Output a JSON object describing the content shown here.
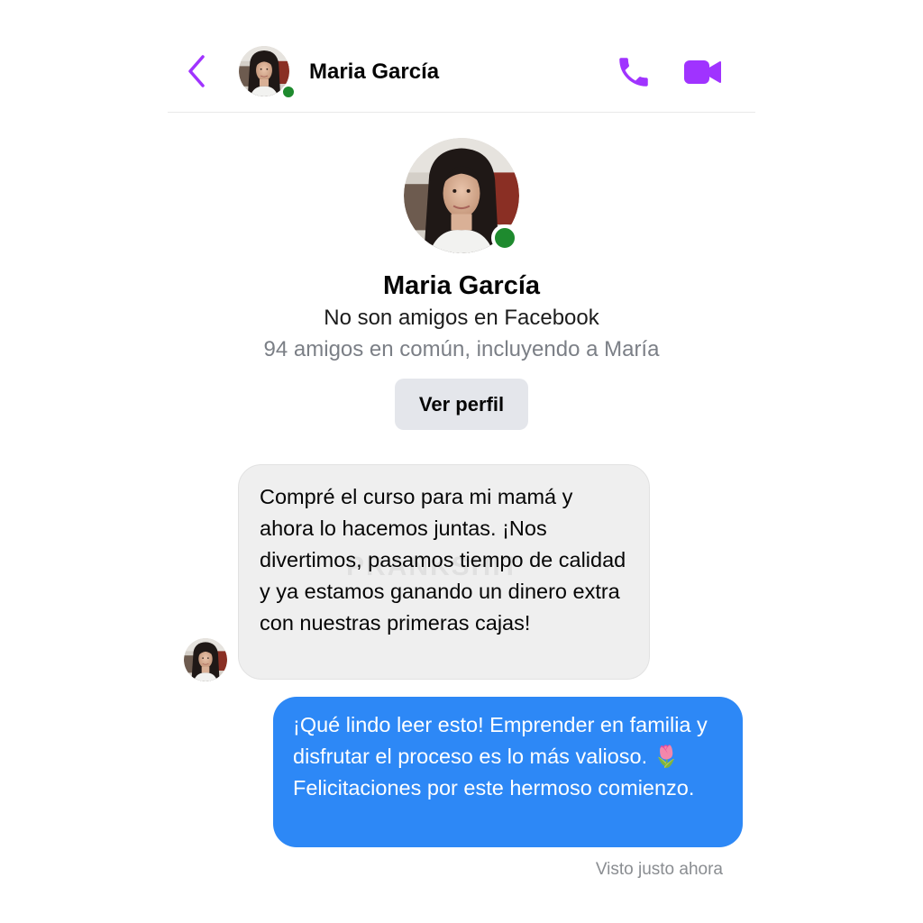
{
  "header": {
    "contact_name": "Maria García",
    "online": true,
    "back_icon": "chevron-left-icon",
    "call_icon": "phone-icon",
    "video_icon": "video-camera-icon"
  },
  "profile": {
    "name": "Maria García",
    "friend_status": "No son amigos en Facebook",
    "mutual_friends": "94 amigos en común, incluyendo a María",
    "view_profile_label": "Ver perfil"
  },
  "messages": [
    {
      "direction": "incoming",
      "text": "Compré el curso para mi mamá y ahora lo hacemos juntas. ¡Nos divertimos, pasamos tiempo de calidad y ya estamos ganando un dinero extra con nuestras primeras cajas!"
    },
    {
      "direction": "outgoing",
      "text": "¡Qué lindo leer esto! Emprender en familia y disfrutar el proceso es lo más valioso. 🌷 Felicitaciones por este hermoso comienzo."
    }
  ],
  "watermark": "PRANKSHIT",
  "seen_status": "Visto justo ahora",
  "colors": {
    "accent": "#a033ff",
    "online": "#1e8a2e",
    "incoming_bubble": "#efefef",
    "outgoing_bubble": "#2d88f6",
    "button_bg": "#e4e6eb",
    "muted_text": "#7b7f86"
  }
}
